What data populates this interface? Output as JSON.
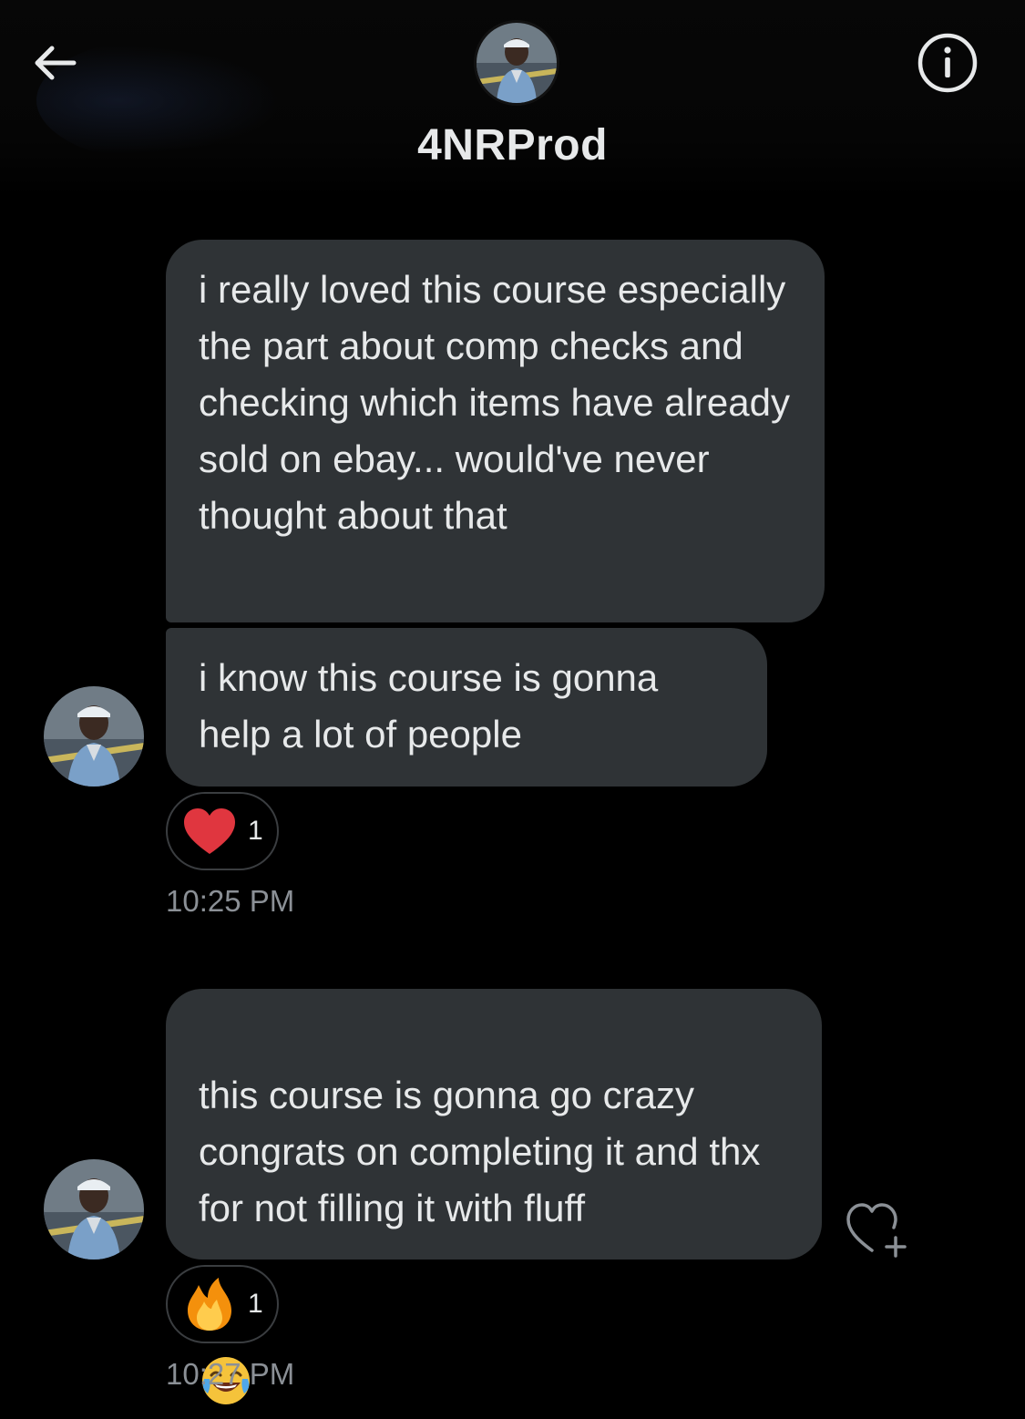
{
  "header": {
    "title": "4NRProd",
    "back_icon": "arrow-left-icon",
    "info_icon": "info-icon"
  },
  "messages": [
    {
      "text": "i really loved this course especially the part about comp checks and checking which items have already sold on ebay... would've never thought about that"
    },
    {
      "text": "i know this course is gonna help a lot of people",
      "reaction": {
        "emoji": "heart",
        "count": "1"
      },
      "time": "10:25 PM"
    },
    {
      "text": "this course is gonna go crazy congrats on completing it and thx for not filling it with fluff",
      "trailing_emoji": "tears-of-joy-emoji",
      "reaction": {
        "emoji": "fire",
        "count": "1"
      },
      "time": "10:27 PM"
    }
  ],
  "colors": {
    "background": "#000000",
    "bubble": "#2f3336",
    "text": "#e7e9ea",
    "muted": "#8b9096",
    "heart": "#e0363f"
  }
}
